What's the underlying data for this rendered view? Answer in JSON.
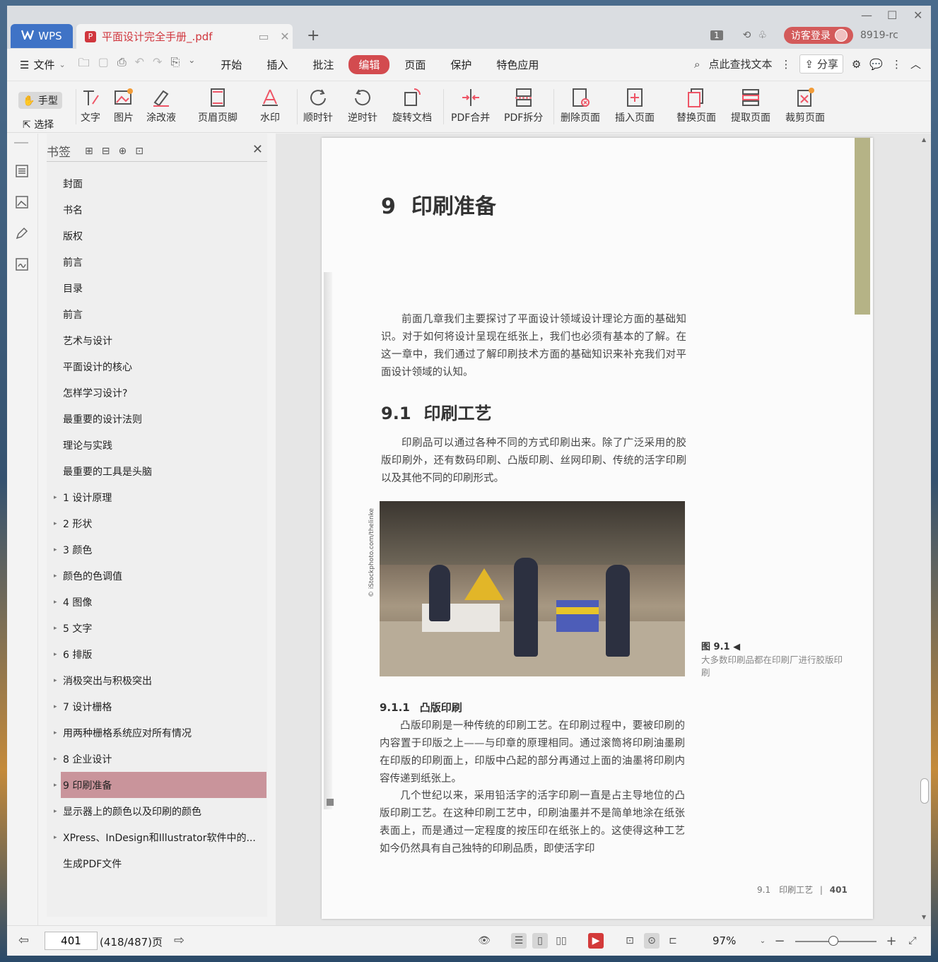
{
  "titlebar": {
    "app_tab": "WPS",
    "doc_tab": "平面设计完全手册_.pdf",
    "page_indicator": "1",
    "login_label": "访客登录",
    "user_id": "8919-rc"
  },
  "menubar": {
    "file_label": "文件",
    "tabs": [
      "开始",
      "插入",
      "批注",
      "编辑",
      "页面",
      "保护",
      "特色应用"
    ],
    "active_tab": "编辑",
    "search_label": "点此查找文本",
    "share_label": "分享"
  },
  "toolbar": {
    "hand_label": "手型",
    "select_label": "选择",
    "buttons": {
      "text": "文字",
      "image": "图片",
      "whiteout": "涂改液",
      "header_footer": "页眉页脚",
      "watermark": "水印",
      "rotate_cw": "顺时针",
      "rotate_ccw": "逆时针",
      "rotate_doc": "旋转文档",
      "pdf_merge": "PDF合并",
      "pdf_split": "PDF拆分",
      "delete_page": "删除页面",
      "insert_page": "插入页面",
      "replace_page": "替换页面",
      "extract_page": "提取页面",
      "crop_page": "裁剪页面"
    }
  },
  "bookmarks": {
    "title": "书签",
    "items": [
      {
        "label": "封面",
        "expandable": false
      },
      {
        "label": "书名",
        "expandable": false
      },
      {
        "label": "版权",
        "expandable": false
      },
      {
        "label": "前言",
        "expandable": false
      },
      {
        "label": "目录",
        "expandable": false
      },
      {
        "label": "前言",
        "expandable": false
      },
      {
        "label": "艺术与设计",
        "expandable": false
      },
      {
        "label": "平面设计的核心",
        "expandable": false
      },
      {
        "label": "怎样学习设计?",
        "expandable": false
      },
      {
        "label": "最重要的设计法则",
        "expandable": false
      },
      {
        "label": "理论与实践",
        "expandable": false
      },
      {
        "label": "最重要的工具是头脑",
        "expandable": false
      },
      {
        "label": "1 设计原理",
        "expandable": true
      },
      {
        "label": "2 形状",
        "expandable": true
      },
      {
        "label": "3 颜色",
        "expandable": true
      },
      {
        "label": "颜色的色调值",
        "expandable": true
      },
      {
        "label": "4 图像",
        "expandable": true
      },
      {
        "label": "5 文字",
        "expandable": true
      },
      {
        "label": "6 排版",
        "expandable": true
      },
      {
        "label": "消极突出与积极突出",
        "expandable": true
      },
      {
        "label": "7 设计栅格",
        "expandable": true
      },
      {
        "label": "用两种栅格系统应对所有情况",
        "expandable": true
      },
      {
        "label": "8 企业设计",
        "expandable": true
      },
      {
        "label": "9 印刷准备",
        "expandable": true,
        "active": true
      },
      {
        "label": "显示器上的颜色以及印刷的颜色",
        "expandable": true
      },
      {
        "label": "XPress、InDesign和Illustrator软件中的...",
        "expandable": true
      },
      {
        "label": "生成PDF文件",
        "expandable": false
      }
    ]
  },
  "page": {
    "chapter_num": "9",
    "chapter_title": "印刷准备",
    "intro": "前面几章我们主要探讨了平面设计领域设计理论方面的基础知识。对于如何将设计呈现在纸张上，我们也必须有基本的了解。在这一章中，我们通过了解印刷技术方面的基础知识来补充我们对平面设计领域的认知。",
    "section_num": "9.1",
    "section_title": "印刷工艺",
    "section_text": "印刷品可以通过各种不同的方式印刷出来。除了广泛采用的胶版印刷外，还有数码印刷、凸版印刷、丝网印刷、传统的活字印刷以及其他不同的印刷形式。",
    "photo_credit": "© iStockphoto.com/thelinke",
    "figure_label": "图 9.1 ◀",
    "figure_caption": "大多数印刷品都在印刷厂进行胶版印刷",
    "subsection_num": "9.1.1",
    "subsection_title": "凸版印刷",
    "para1": "凸版印刷是一种传统的印刷工艺。在印刷过程中，要被印刷的内容置于印版之上——与印章的原理相同。通过滚筒将印刷油墨刷在印版的印刷面上，印版中凸起的部分再通过上面的油墨将印刷内容传递到纸张上。",
    "para2": "几个世纪以来，采用铅活字的活字印刷一直是占主导地位的凸版印刷工艺。在这种印刷工艺中，印刷油墨并不是简单地涂在纸张表面上，而是通过一定程度的按压印在纸张上的。这使得这种工艺如今仍然具有自己独特的印刷品质，即使活字印",
    "footer_section": "9.1　印刷工艺",
    "footer_sep": "|",
    "footer_page": "401"
  },
  "statusbar": {
    "page_input": "401",
    "page_total": "(418/487)页",
    "zoom": "97%"
  },
  "colors": {
    "accent_red": "#d34b4f",
    "wps_blue": "#3f73c6",
    "active_bookmark": "#c9949b"
  }
}
